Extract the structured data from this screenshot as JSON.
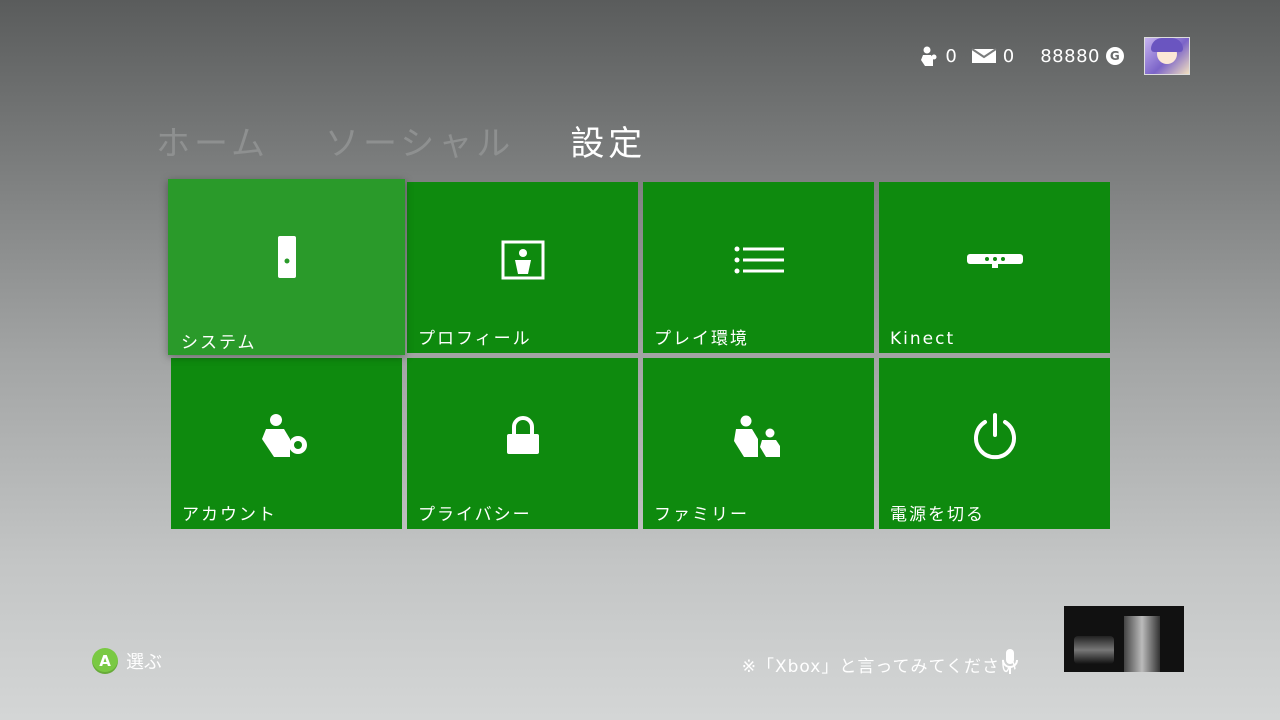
{
  "status": {
    "friends_count": "0",
    "messages_count": "0",
    "gamerscore": "88880",
    "gamerscore_symbol": "G"
  },
  "nav": {
    "tabs": [
      {
        "label": "ホーム"
      },
      {
        "label": "ソーシャル"
      },
      {
        "label": "設定"
      }
    ],
    "active": "設定"
  },
  "tiles": [
    {
      "label": "システム",
      "icon": "console-icon"
    },
    {
      "label": "プロフィール",
      "icon": "profile-icon"
    },
    {
      "label": "プレイ環境",
      "icon": "list-icon"
    },
    {
      "label": "Kinect",
      "icon": "kinect-icon"
    },
    {
      "label": "アカウント",
      "icon": "account-settings-icon"
    },
    {
      "label": "プライバシー",
      "icon": "lock-icon"
    },
    {
      "label": "ファミリー",
      "icon": "family-icon"
    },
    {
      "label": "電源を切る",
      "icon": "power-icon"
    }
  ],
  "hint": {
    "button": "A",
    "label": "選ぶ"
  },
  "voice_prompt": "※「Xbox」と言ってみてください",
  "colors": {
    "tile": "#0e8a0e",
    "tile_focused": "#2a9a2a",
    "a_button": "#7ac943"
  }
}
